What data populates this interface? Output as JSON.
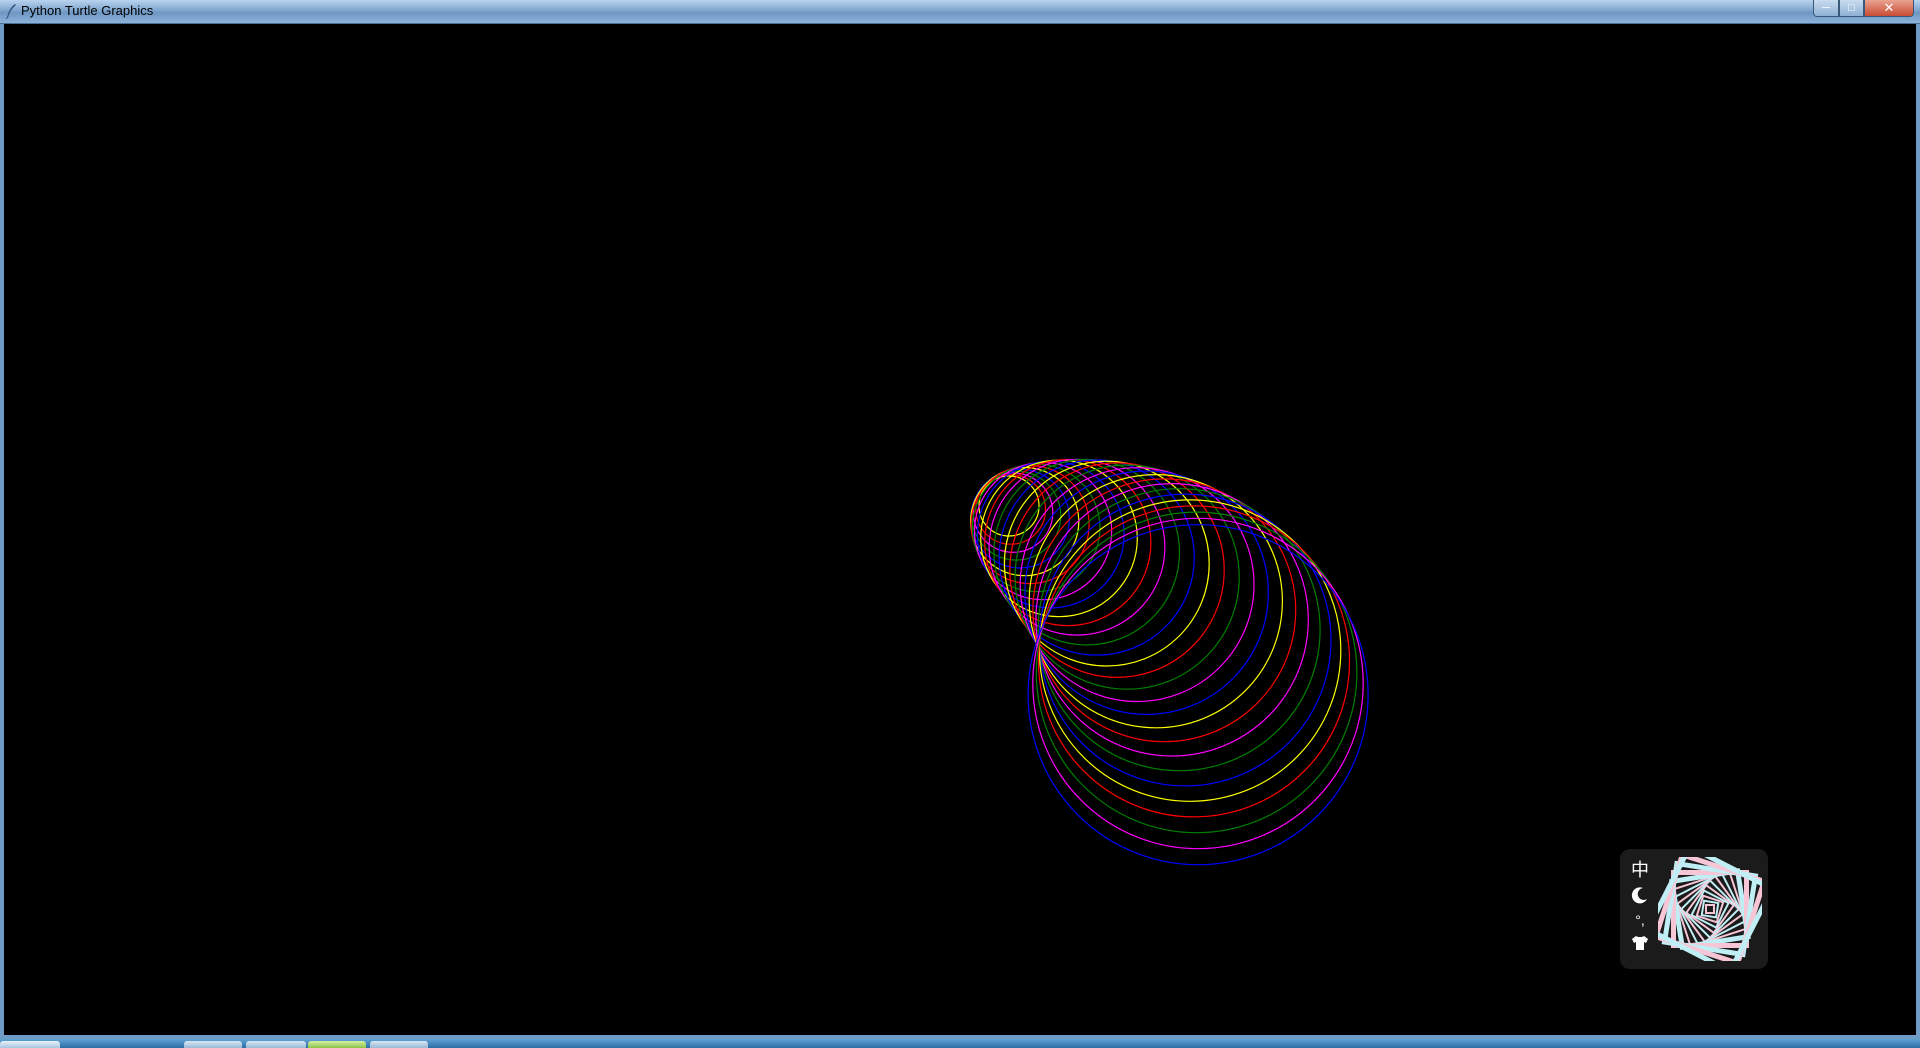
{
  "window": {
    "title": "Python Turtle Graphics",
    "buttons": {
      "minimize": "─",
      "maximize": "□",
      "close": "✕"
    }
  },
  "canvas": {
    "background": "#000000",
    "drawing": {
      "description_colors": [
        "#0000ff",
        "#008000",
        "#ffff00",
        "#ff0000",
        "#ff00ff",
        "#ffa500"
      ]
    }
  },
  "ime": {
    "mode_label": "中",
    "moon_icon": "moon-icon",
    "punct_label": "°,",
    "skin_icon": "shirt-icon"
  },
  "colors": {
    "titlebar": "#7fa6cf",
    "canvas_bg": "#000000",
    "ime_bg": "#1b1b1b",
    "logo_light": "#bfeff5",
    "logo_pink": "#f6c6d6"
  }
}
